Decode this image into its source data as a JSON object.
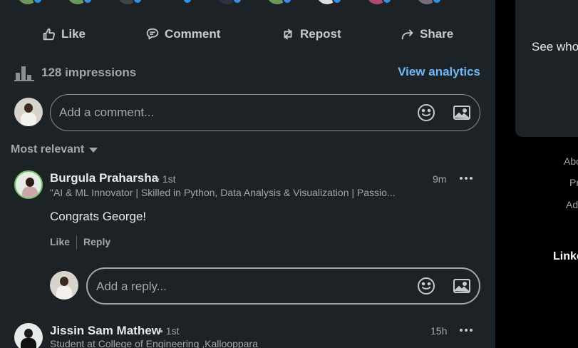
{
  "post": {
    "actions": {
      "like": "Like",
      "comment": "Comment",
      "repost": "Repost",
      "share": "Share"
    },
    "impressions": "128 impressions",
    "view_analytics": "View analytics",
    "comment_placeholder": "Add a comment...",
    "sort_label": "Most relevant"
  },
  "comments": [
    {
      "name": "Burgula Praharsha",
      "degree": "• 1st",
      "headline": "\"AI & ML Innovator | Skilled in Python, Data Analysis & Visualization | Passio...",
      "time": "9m",
      "text": "Congrats George!",
      "like": "Like",
      "reply": "Reply"
    },
    {
      "name": "Jissin Sam Mathew",
      "degree": "• 1st",
      "headline": "Student at College of Engineering ,Kallooppara",
      "time": "15h"
    }
  ],
  "reply_placeholder": "Add a reply...",
  "sidebar": {
    "see_who": "See who",
    "footer": [
      "Abo",
      "Pr",
      "Ad"
    ],
    "brand": "Linke"
  },
  "colors": {
    "background": "#000000",
    "card": "#1d2226",
    "accent": "#71b7fb",
    "badge": "#378fe9"
  }
}
